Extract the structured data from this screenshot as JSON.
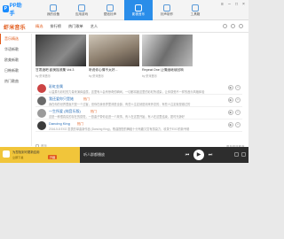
{
  "app": {
    "logo_text": "PP助手"
  },
  "nav": [
    {
      "label": "我的设备",
      "active": false
    },
    {
      "label": "应用游戏",
      "active": false
    },
    {
      "label": "壁纸铃声",
      "active": false
    },
    {
      "label": "影视音乐",
      "active": true
    },
    {
      "label": "铃声制作",
      "active": false
    },
    {
      "label": "工具箱",
      "active": false
    }
  ],
  "brand": {
    "name": "虾米音乐"
  },
  "tabs": [
    {
      "label": "精选",
      "active": true
    },
    {
      "label": "排行榜",
      "active": false
    },
    {
      "label": "热门歌单",
      "active": false
    },
    {
      "label": "艺人",
      "active": false
    }
  ],
  "sidebar": [
    {
      "label": "音乐精选",
      "active": true
    },
    {
      "label": "华语新歌",
      "active": false
    },
    {
      "label": "欧美新歌",
      "active": false
    },
    {
      "label": "日韩新歌",
      "active": false
    },
    {
      "label": "热门歌曲",
      "active": false
    }
  ],
  "cards": [
    {
      "title": "甘肃酒吧 欧美摇滚集 Vol.3",
      "sub": "by 虾米音乐"
    },
    {
      "title": "听说你心情不太好...",
      "sub": "by 虾米音乐"
    },
    {
      "title": "Repeat One 让情绪继续回响",
      "sub": "by 虾米音乐"
    }
  ],
  "list": [
    {
      "name": "彩虹金属",
      "badge": "",
      "desc": "以温柔与彩虹的力量来演绎金属，这里有人会有惊奇的瞬间，一切都将被这里的彩虹所浸染，让你感受不一样的音乐风格体验"
    },
    {
      "name": "我还爱你只是她",
      "badge": "热门",
      "desc": "我在你的世界里面只是一个过客，但你在我世界里却是全部，有些人注定就是用来怀念的，有些人注定就是错过的"
    },
    {
      "name": "一生所爱 (纯音乐版)",
      "badge": "热门",
      "desc": "这是一种很真实的存在的感觉，一首曲子带你走进一个故事，有人在这里开始，有人在这里结束，愿时光静好"
    },
    {
      "name": "Dancing King",
      "badge": "热门",
      "desc": "2016-5-8 EXO 发表的单曲新作品 (Dancing King)，歌曲搭配的舞蹈十分有趣又富有感染力，收录于EXO的新专辑"
    }
  ],
  "pager": {
    "label": "首页"
  },
  "more": {
    "label": "更多精选推荐"
  },
  "promo": {
    "line1": "为您找到可更新应用",
    "line2": "立即下载",
    "button": "升级"
  },
  "nowplaying": {
    "label": "听人群都播放"
  },
  "colors": {
    "accent": "#e15a1a",
    "nav_active": "#2a8de9",
    "player_bg": "#2d2d2d",
    "promo_bg": "#f1c53a"
  }
}
